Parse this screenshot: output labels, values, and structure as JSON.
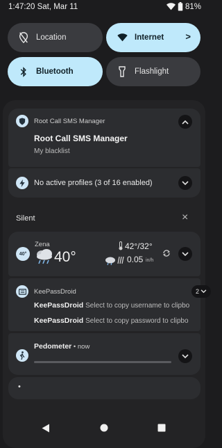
{
  "status_bar": {
    "time_date": "1:47:20 Sat, Mar 11",
    "battery": "81%"
  },
  "tiles": [
    {
      "label": "Location",
      "state": "off",
      "icon": "location-off-icon"
    },
    {
      "label": "Internet",
      "state": "on",
      "icon": "wifi-icon",
      "chevron": ">"
    },
    {
      "label": "Bluetooth",
      "state": "on",
      "icon": "bluetooth-icon"
    },
    {
      "label": "Flashlight",
      "state": "off",
      "icon": "flashlight-icon"
    }
  ],
  "notifications": {
    "root_call": {
      "app_name": "Root Call SMS Manager",
      "title": "Root Call SMS Manager",
      "text": "My blacklist"
    },
    "profiles": {
      "text": "No active profiles (3 of 16 enabled)"
    },
    "silent_header": {
      "label": "Silent",
      "clear": "×"
    },
    "weather": {
      "badge": "40°",
      "location": "Zena",
      "temp": "40°",
      "hi_lo": "42°/32°",
      "wind": "0.05",
      "wind_unit": "in/h"
    },
    "keepass": {
      "app_name": "KeePassDroid",
      "count": "2",
      "rows": [
        {
          "app": "KeePassDroid",
          "text": "Select to copy username to clipbo"
        },
        {
          "app": "KeePassDroid",
          "text": "Select to copy password to clipbo"
        }
      ]
    },
    "pedometer": {
      "title": "Pedometer",
      "time": "now",
      "separator": " • "
    },
    "last_card": {
      "dot": "•"
    }
  },
  "colors": {
    "accent_tile": "#bfe9fb",
    "card": "#2c2d30",
    "background": "#1c1c1e"
  }
}
